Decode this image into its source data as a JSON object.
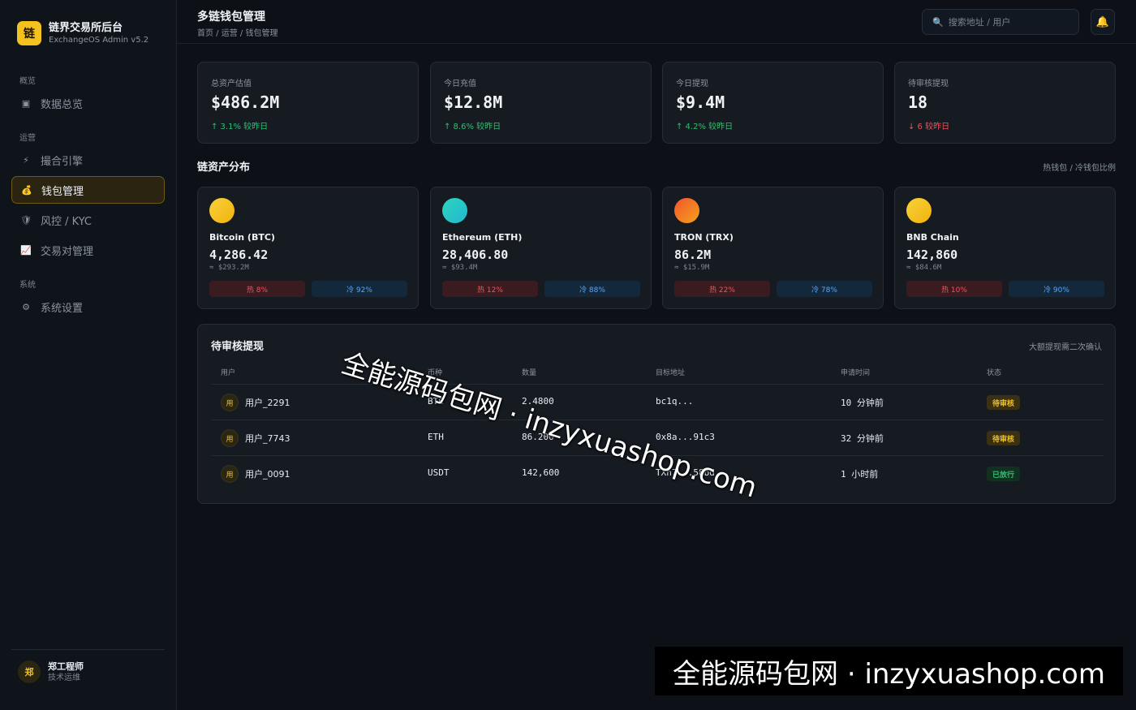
{
  "brand": {
    "logo": "链",
    "title": "链界交易所后台",
    "subtitle": "ExchangeOS Admin v5.2"
  },
  "nav": {
    "sections": [
      "概览",
      "运营",
      "系统"
    ],
    "items": [
      {
        "icon": "▣",
        "label": "数据总览"
      },
      {
        "icon": "⚡",
        "label": "撮合引擎"
      },
      {
        "icon": "💰",
        "label": "钱包管理"
      },
      {
        "icon": "🛡",
        "label": "风控 / KYC"
      },
      {
        "icon": "📈",
        "label": "交易对管理"
      },
      {
        "icon": "⚙",
        "label": "系统设置"
      }
    ],
    "active": "钱包管理"
  },
  "user": {
    "avatar": "郑",
    "name": "郑工程师",
    "role": "技术运维"
  },
  "header": {
    "title": "多链钱包管理",
    "breadcrumb": "首页 / 运营 / 钱包管理",
    "search_icon": "🔍",
    "search_placeholder": "搜索地址 / 用户",
    "bell_icon": "🔔"
  },
  "stats": [
    {
      "label": "总资产估值",
      "value": "$486.2M",
      "change": "↑ 3.1% 较昨日",
      "trend": "up"
    },
    {
      "label": "今日充值",
      "value": "$12.8M",
      "change": "↑ 8.6% 较昨日",
      "trend": "up"
    },
    {
      "label": "今日提现",
      "value": "$9.4M",
      "change": "↑ 4.2% 较昨日",
      "trend": "up"
    },
    {
      "label": "待审核提现",
      "value": "18",
      "change": "↓ 6 较昨日",
      "trend": "down"
    }
  ],
  "chains_section": {
    "title": "链资产分布",
    "note": "热钱包 / 冷钱包比例"
  },
  "chains": [
    {
      "name": "Bitcoin (BTC)",
      "amount": "4,286.42",
      "usd": "≈ $293.2M",
      "hot": "热 8%",
      "cold": "冷 92%",
      "color_a": "#f7d23a",
      "color_b": "#f3b20f"
    },
    {
      "name": "Ethereum (ETH)",
      "amount": "28,406.80",
      "usd": "≈ $93.4M",
      "hot": "热 12%",
      "cold": "冷 88%",
      "color_a": "#2dd4bf",
      "color_b": "#22b8cf"
    },
    {
      "name": "TRON (TRX)",
      "amount": "86.2M",
      "usd": "≈ $15.9M",
      "hot": "热 22%",
      "cold": "冷 78%",
      "color_a": "#f1552f",
      "color_b": "#f6a21b"
    },
    {
      "name": "BNB Chain",
      "amount": "142,860",
      "usd": "≈ $84.6M",
      "hot": "热 10%",
      "cold": "冷 90%",
      "color_a": "#f7d23a",
      "color_b": "#f3b20f"
    }
  ],
  "withdrawals": {
    "title": "待审核提现",
    "note": "大额提现需二次确认",
    "columns": [
      "用户",
      "币种",
      "数量",
      "目标地址",
      "申请时间",
      "状态"
    ],
    "rows": [
      {
        "avatar": "用",
        "user": "用户_2291",
        "coin": "BTC",
        "amount": "2.4800",
        "address": "bc1q...",
        "time": "10 分钟前",
        "status": "待审核",
        "status_type": "pending"
      },
      {
        "avatar": "用",
        "user": "用户_7743",
        "coin": "ETH",
        "amount": "86.200",
        "address": "0x8a...91c3",
        "time": "32 分钟前",
        "status": "待审核",
        "status_type": "pending"
      },
      {
        "avatar": "用",
        "user": "用户_0091",
        "coin": "USDT",
        "amount": "142,600",
        "address": "TXn7...58bd",
        "time": "1 小时前",
        "status": "已放行",
        "status_type": "ok"
      }
    ]
  },
  "watermark": {
    "text": "全能源码包网 · inzyxuashop.com"
  },
  "colors": {
    "accent": "#f3c21f",
    "up": "#2fbf71",
    "down": "#f0525c",
    "cold": "#58a6ff"
  }
}
